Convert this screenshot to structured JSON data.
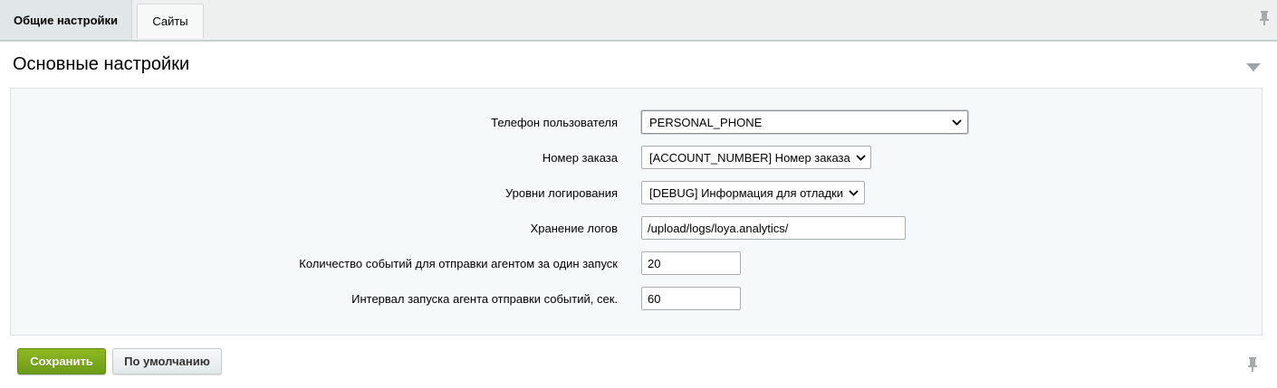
{
  "tabs": [
    {
      "label": "Общие настройки",
      "active": true
    },
    {
      "label": "Сайты",
      "active": false
    }
  ],
  "section": {
    "title": "Основные настройки"
  },
  "form": {
    "rows": [
      {
        "label": "Телефон пользователя",
        "type": "select",
        "value": "PERSONAL_PHONE"
      },
      {
        "label": "Номер заказа",
        "type": "select",
        "value": "[ACCOUNT_NUMBER] Номер заказа"
      },
      {
        "label": "Уровни логирования",
        "type": "select",
        "value": "[DEBUG] Информация для отладки"
      },
      {
        "label": "Хранение логов",
        "type": "text",
        "value": "/upload/logs/loya.analytics/"
      },
      {
        "label": "Количество событий для отправки агентом за один запуск",
        "type": "text",
        "value": "20"
      },
      {
        "label": "Интервал запуска агента отправки событий, сек.",
        "type": "text",
        "value": "60"
      }
    ]
  },
  "buttons": {
    "save": "Сохранить",
    "default": "По умолчанию"
  },
  "colors": {
    "save_button": "#7aa81c",
    "panel_bg": "#f5f9f9",
    "tabbar_bg": "#eef0f0"
  },
  "icons": [
    "pin-icon",
    "collapse-arrow-icon",
    "chevron-down-icon"
  ]
}
